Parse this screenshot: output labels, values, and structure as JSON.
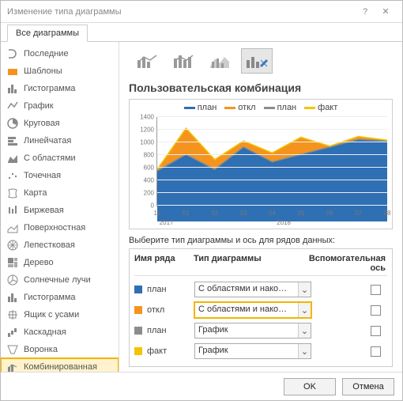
{
  "dialog": {
    "title": "Изменение типа диаграммы"
  },
  "tabs": {
    "all": "Все диаграммы"
  },
  "sidebar": {
    "items": [
      "Последние",
      "Шаблоны",
      "Гистограмма",
      "График",
      "Круговая",
      "Линейчатая",
      "С областями",
      "Точечная",
      "Карта",
      "Биржевая",
      "Поверхностная",
      "Лепестковая",
      "Дерево",
      "Солнечные лучи",
      "Гистограмма",
      "Ящик с усами",
      "Каскадная",
      "Воронка",
      "Комбинированная"
    ],
    "selected": 18
  },
  "section": {
    "title": "Пользовательская комбинация",
    "grid_label": "Выберите тип диаграммы и ось для рядов данных:",
    "col_name": "Имя ряда",
    "col_type": "Тип диаграммы",
    "col_axis": "Вспомогательная ось"
  },
  "chart_data": {
    "type": "area",
    "title": "",
    "xlabel": "",
    "ylabel": "",
    "ylim": [
      0,
      1400
    ],
    "yticks": [
      0,
      200,
      400,
      600,
      800,
      1000,
      1200,
      1400
    ],
    "categories": [
      "12",
      "01",
      "02",
      "03",
      "04",
      "05",
      "06",
      "07",
      "08"
    ],
    "x_groups": [
      "2017",
      "2018"
    ],
    "legend": [
      "план",
      "откл",
      "план",
      "факт"
    ],
    "colors": {
      "plan_area": "#2F6FB3",
      "dev_area": "#F4941E",
      "plan_line": "#8C8C8C",
      "fact_line": "#F4C400"
    },
    "series": [
      {
        "name": "план",
        "kind": "area",
        "color": "#2F6FB3",
        "values": [
          680,
          900,
          700,
          1000,
          800,
          900,
          1000,
          1100,
          1080
        ]
      },
      {
        "name": "откл",
        "kind": "area_stack",
        "color": "#F4941E",
        "values": [
          20,
          350,
          130,
          80,
          120,
          230,
          10,
          40,
          10
        ]
      },
      {
        "name": "план",
        "kind": "line",
        "color": "#8C8C8C",
        "values": [
          680,
          900,
          700,
          1000,
          800,
          900,
          1000,
          1100,
          1080
        ]
      },
      {
        "name": "факт",
        "kind": "line",
        "color": "#F4C400",
        "values": [
          700,
          1250,
          830,
          1080,
          920,
          1130,
          1010,
          1140,
          1090
        ]
      }
    ]
  },
  "rows": [
    {
      "name": "план",
      "color": "#2F6FB3",
      "type": "С областями и нако…",
      "hl": false
    },
    {
      "name": "откл",
      "color": "#F4941E",
      "type": "С областями и нако…",
      "hl": true
    },
    {
      "name": "план",
      "color": "#8C8C8C",
      "type": "График",
      "hl": false
    },
    {
      "name": "факт",
      "color": "#F4C400",
      "type": "График",
      "hl": false
    }
  ],
  "footer": {
    "ok": "OK",
    "cancel": "Отмена"
  }
}
